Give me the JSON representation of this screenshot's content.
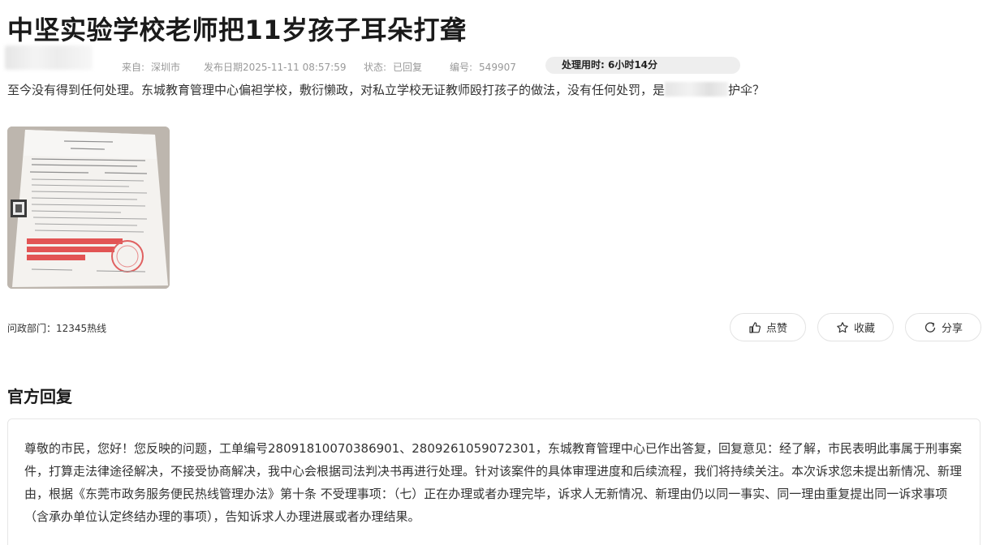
{
  "post": {
    "title": "中坚实验学校老师把11岁孩子耳朵打聋",
    "from_label": "来自:",
    "from_value": "深圳市",
    "date_label": "发布日期",
    "date_value": "2025-11-11 08:57:59",
    "status_label": "状态:",
    "status_value": "已回复",
    "id_label": "编号:",
    "id_value": "549907",
    "processing_time": "处理用时:  6小时14分",
    "content_before": "至今没有得到任何处理。东城教育管理中心偏袒学校，敷衍懒政，对私立学校无证教师殴打孩子的做法，没有任何处罚，是",
    "content_after": "护伞？",
    "department": "问政部门：12345热线"
  },
  "actions": {
    "like_label": "点赞",
    "favorite_label": "收藏",
    "share_label": "分享"
  },
  "reply": {
    "heading": "官方回复",
    "text": "尊敬的市民，您好！您反映的问题，工单编号28091810070386901、2809261059072301，东城教育管理中心已作出答复，回复意见：经了解，市民表明此事属于刑事案件，打算走法律途径解决，不接受协商解决，我中心会根据司法判决书再进行处理。针对该案件的具体审理进度和后续流程，我们将持续关注。本次诉求您未提出新情况、新理由，根据《东莞市政务服务便民热线管理办法》第十条 不受理事项：（七）正在办理或者办理完毕，诉求人无新情况、新理由仍以同一事实、同一理由重复提出同一诉求事项（含承办单位认定终结办理的事项），告知诉求人办理进展或者办理结果。"
  },
  "icons": {
    "like": "thumbs-up-icon",
    "favorite": "star-icon",
    "share": "share-refresh-icon"
  }
}
